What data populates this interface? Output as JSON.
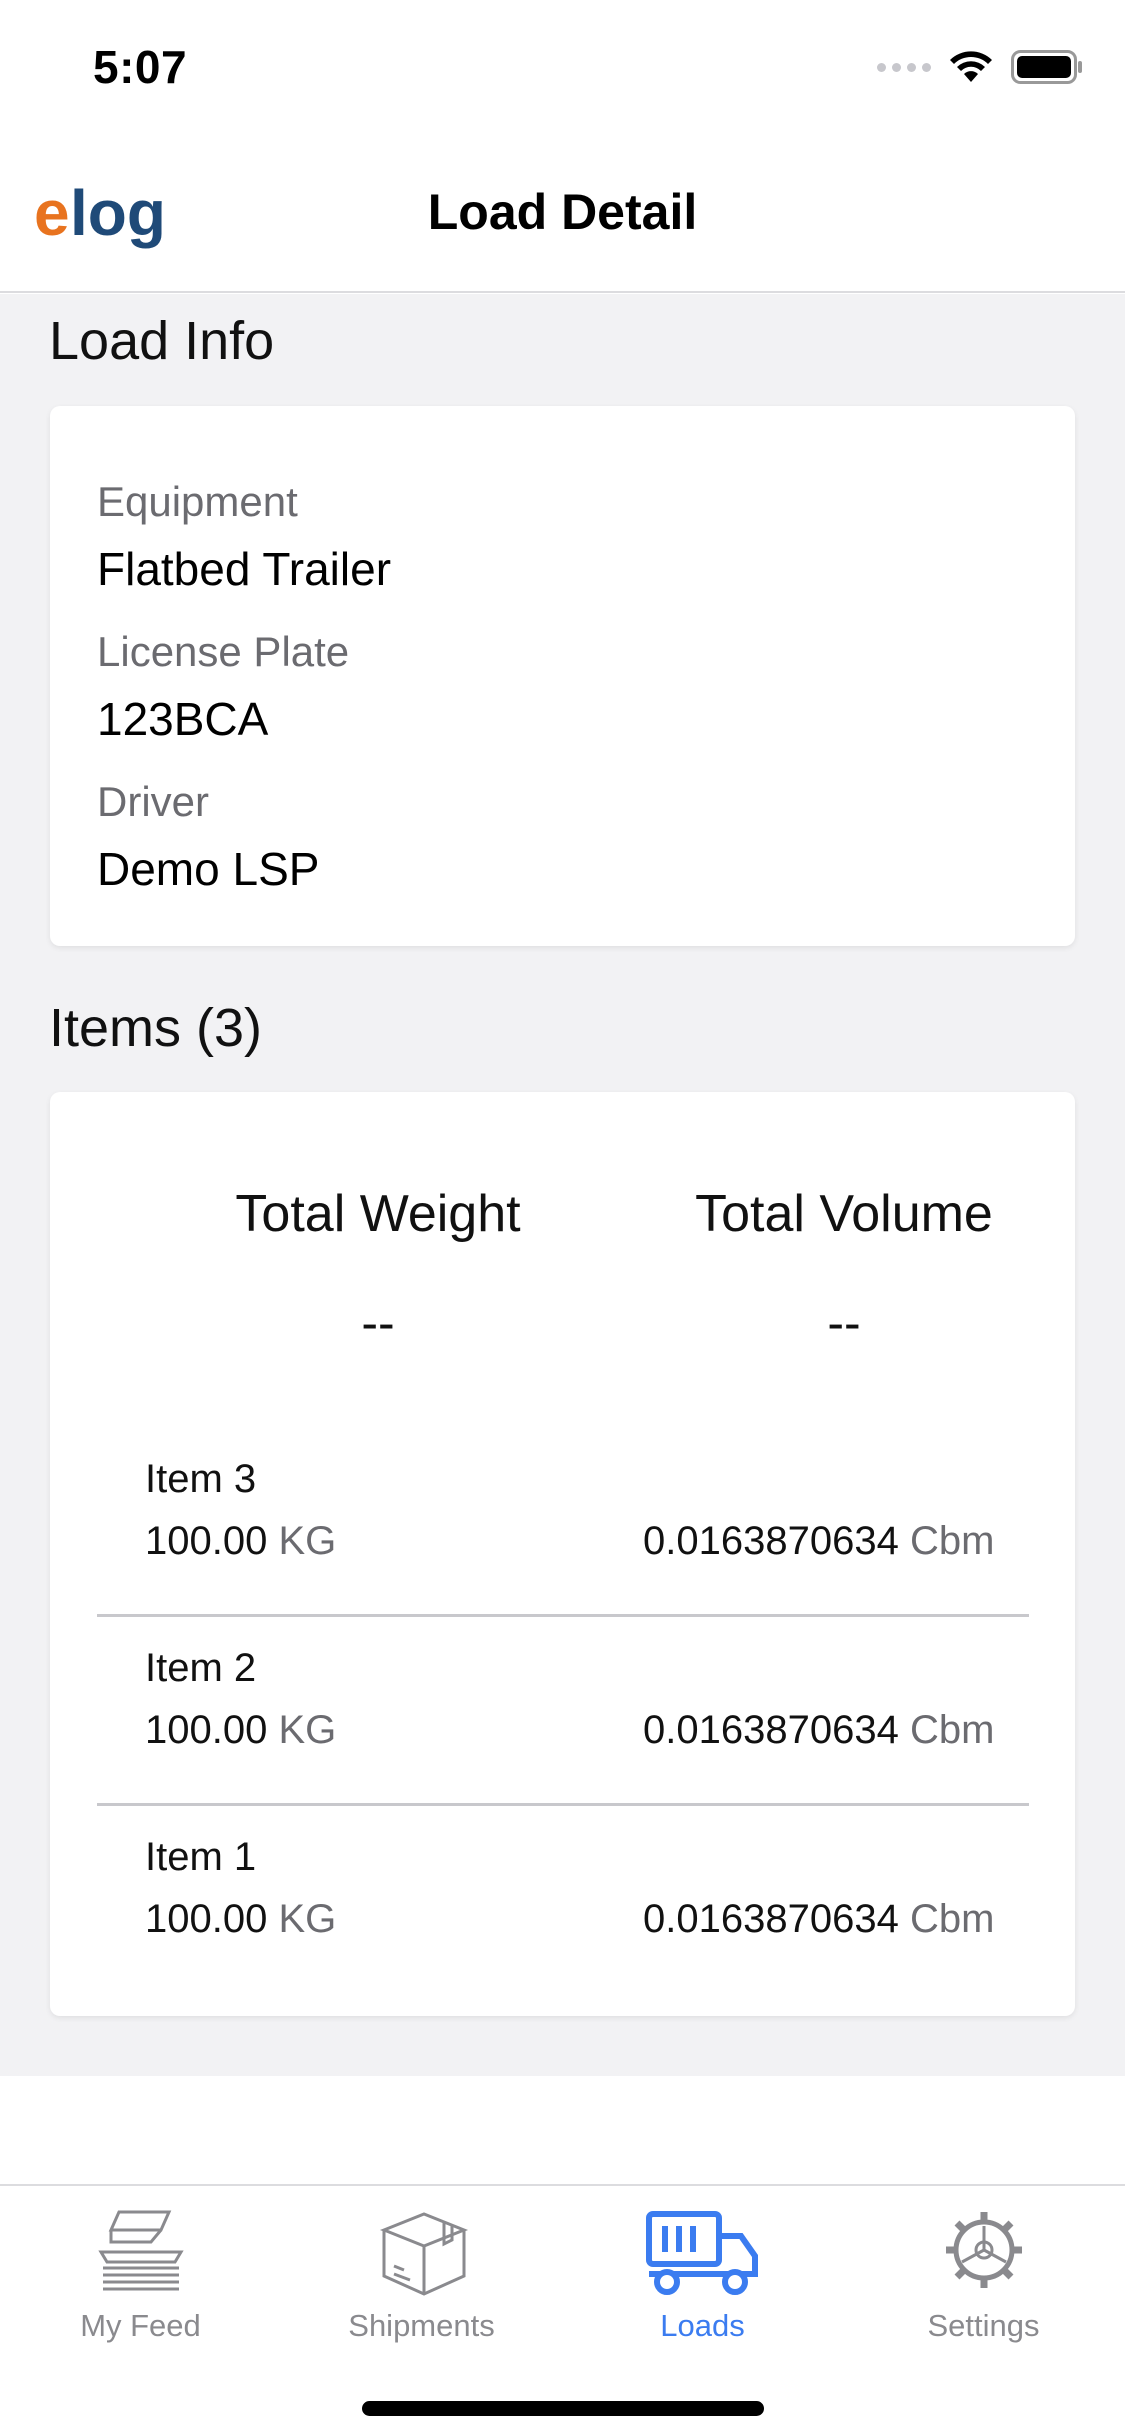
{
  "status_bar": {
    "time": "5:07"
  },
  "header": {
    "title": "Load Detail",
    "logo_text": "elog"
  },
  "load_info": {
    "title": "Load Info",
    "fields": [
      {
        "label": "Equipment",
        "value": "Flatbed Trailer"
      },
      {
        "label": "License Plate",
        "value": "123BCA"
      },
      {
        "label": "Driver",
        "value": "Demo LSP"
      }
    ]
  },
  "items": {
    "title": "Items (3)",
    "total_weight_label": "Total Weight",
    "total_volume_label": "Total Volume",
    "total_weight_value": "--",
    "total_volume_value": "--",
    "rows": [
      {
        "name": "Item 3",
        "weight": "100.00",
        "weight_unit": "KG",
        "volume": "0.0163870634",
        "volume_unit": "Cbm"
      },
      {
        "name": "Item 2",
        "weight": "100.00",
        "weight_unit": "KG",
        "volume": "0.0163870634",
        "volume_unit": "Cbm"
      },
      {
        "name": "Item 1",
        "weight": "100.00",
        "weight_unit": "KG",
        "volume": "0.0163870634",
        "volume_unit": "Cbm"
      }
    ]
  },
  "tabs": [
    {
      "label": "My Feed",
      "icon": "feed-icon",
      "active": false
    },
    {
      "label": "Shipments",
      "icon": "box-icon",
      "active": false
    },
    {
      "label": "Loads",
      "icon": "truck-icon",
      "active": true
    },
    {
      "label": "Settings",
      "icon": "gear-icon",
      "active": false
    }
  ],
  "colors": {
    "accent": "#3b7cf0",
    "logo_orange": "#e8731f",
    "logo_navy": "#1f4a78",
    "background": "#f2f2f4"
  }
}
